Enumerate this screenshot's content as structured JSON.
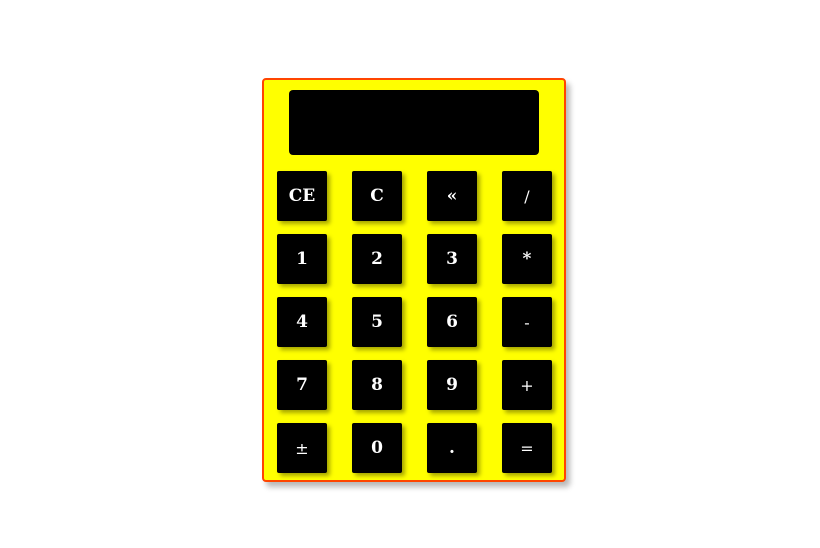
{
  "calculator": {
    "display_value": "",
    "colors": {
      "body": "#ffff00",
      "border": "#ff4500",
      "display": "#000000",
      "key": "#000000",
      "key_text": "#ffffff"
    },
    "keys": [
      {
        "label": "CE",
        "name": "clear-entry-button",
        "icon": ""
      },
      {
        "label": "C",
        "name": "clear-button",
        "icon": ""
      },
      {
        "label": "«",
        "name": "backspace-button",
        "icon": "backspace-icon"
      },
      {
        "label": "/",
        "name": "divide-button",
        "icon": ""
      },
      {
        "label": "1",
        "name": "digit-1-button",
        "icon": ""
      },
      {
        "label": "2",
        "name": "digit-2-button",
        "icon": ""
      },
      {
        "label": "3",
        "name": "digit-3-button",
        "icon": ""
      },
      {
        "label": "*",
        "name": "multiply-button",
        "icon": ""
      },
      {
        "label": "4",
        "name": "digit-4-button",
        "icon": ""
      },
      {
        "label": "5",
        "name": "digit-5-button",
        "icon": ""
      },
      {
        "label": "6",
        "name": "digit-6-button",
        "icon": ""
      },
      {
        "label": "-",
        "name": "subtract-button",
        "icon": ""
      },
      {
        "label": "7",
        "name": "digit-7-button",
        "icon": ""
      },
      {
        "label": "8",
        "name": "digit-8-button",
        "icon": ""
      },
      {
        "label": "9",
        "name": "digit-9-button",
        "icon": ""
      },
      {
        "label": "+",
        "name": "add-button",
        "icon": ""
      },
      {
        "label": "±",
        "name": "toggle-sign-button",
        "icon": ""
      },
      {
        "label": "0",
        "name": "digit-0-button",
        "icon": ""
      },
      {
        "label": ".",
        "name": "decimal-button",
        "icon": ""
      },
      {
        "label": "=",
        "name": "equals-button",
        "icon": ""
      }
    ]
  }
}
